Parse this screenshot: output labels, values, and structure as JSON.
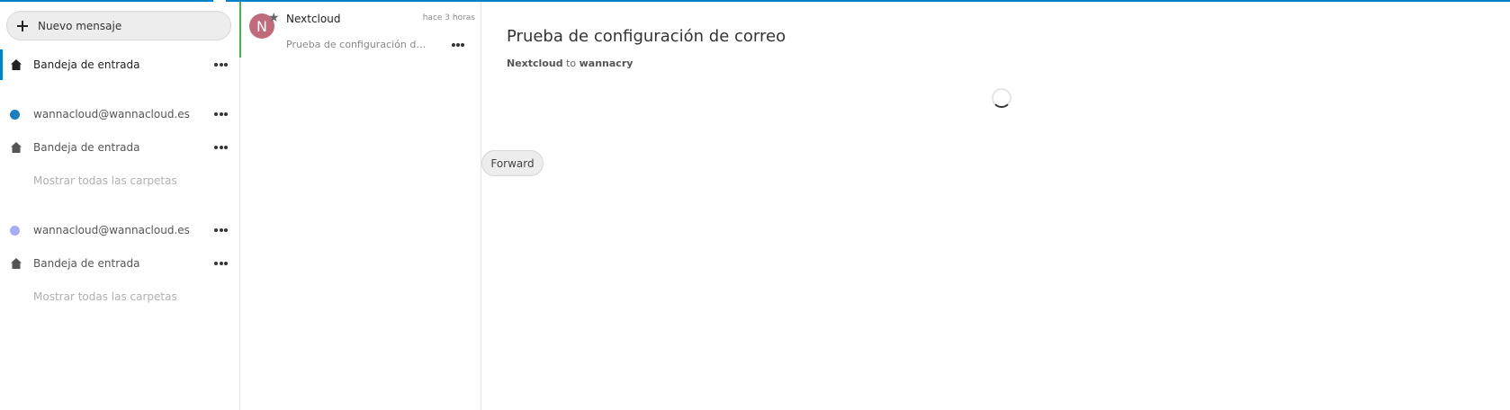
{
  "sidebar": {
    "new_message_label": "Nuevo mensaje",
    "unified_inbox_label": "Bandeja de entrada",
    "accounts": [
      {
        "email": "wannacloud@wannacloud.es",
        "color": "#1b7fbf",
        "inbox_label": "Bandeja de entrada",
        "show_all_label": "Mostrar todas las carpetas"
      },
      {
        "email": "wannacloud@wannacloud.es",
        "color": "#a8acf5",
        "inbox_label": "Bandeja de entrada",
        "show_all_label": "Mostrar todas las carpetas"
      }
    ]
  },
  "message_list": {
    "messages": [
      {
        "avatar_initial": "N",
        "from": "Nextcloud",
        "time": "hace 3 horas",
        "subject": "Prueba de configuración de correo"
      }
    ]
  },
  "reading_pane": {
    "subject": "Prueba de configuración de correo",
    "from": "Nextcloud",
    "to_word": "to",
    "to": "wannacry",
    "forward_label": "Forward"
  },
  "colors": {
    "accent": "#0082c9",
    "selected_bar": "#4caf50",
    "avatar": "#c06b7c"
  }
}
